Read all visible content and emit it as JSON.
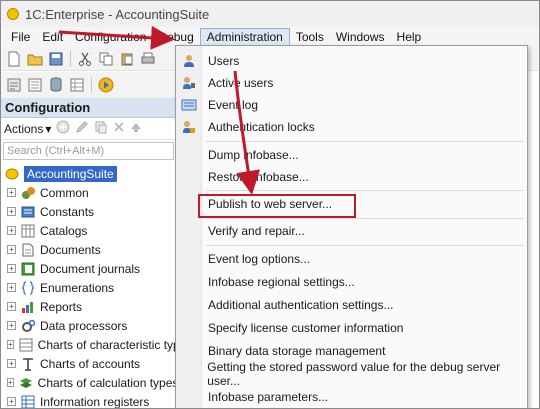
{
  "window": {
    "title": "1C:Enterprise - AccountingSuite"
  },
  "menubar": {
    "items": [
      {
        "label": "File",
        "active": false
      },
      {
        "label": "Edit",
        "active": false
      },
      {
        "label": "Configuration",
        "active": false
      },
      {
        "label": "Debug",
        "active": false
      },
      {
        "label": "Administration",
        "active": true
      },
      {
        "label": "Tools",
        "active": false
      },
      {
        "label": "Windows",
        "active": false
      },
      {
        "label": "Help",
        "active": false
      }
    ]
  },
  "config_panel": {
    "title": "Configuration",
    "actions_label": "Actions",
    "search_placeholder": "Search (Ctrl+Alt+M)",
    "root": "AccountingSuite",
    "items": [
      {
        "label": "Common",
        "icon": "common-icon"
      },
      {
        "label": "Constants",
        "icon": "constants-icon"
      },
      {
        "label": "Catalogs",
        "icon": "catalogs-icon"
      },
      {
        "label": "Documents",
        "icon": "documents-icon"
      },
      {
        "label": "Document journals",
        "icon": "document-journals-icon"
      },
      {
        "label": "Enumerations",
        "icon": "enumerations-icon"
      },
      {
        "label": "Reports",
        "icon": "reports-icon"
      },
      {
        "label": "Data processors",
        "icon": "data-processors-icon"
      },
      {
        "label": "Charts of characteristic types",
        "icon": "charts-of-characteristic-types-icon"
      },
      {
        "label": "Charts of accounts",
        "icon": "charts-of-accounts-icon"
      },
      {
        "label": "Charts of calculation types",
        "icon": "charts-of-calculation-types-icon"
      },
      {
        "label": "Information registers",
        "icon": "information-registers-icon"
      }
    ]
  },
  "admin_menu": {
    "groups": [
      [
        {
          "label": "Users",
          "icon": "users-icon"
        },
        {
          "label": "Active users",
          "icon": "active-users-icon"
        },
        {
          "label": "Event log",
          "icon": "event-log-icon"
        },
        {
          "label": "Authentication locks",
          "icon": "authentication-locks-icon"
        }
      ],
      [
        {
          "label": "Dump infobase..."
        },
        {
          "label": "Restore infobase..."
        }
      ],
      [
        {
          "label": "Publish to web server..."
        }
      ],
      [
        {
          "label": "Verify and repair..."
        }
      ],
      [
        {
          "label": "Event log options..."
        },
        {
          "label": "Infobase regional settings..."
        },
        {
          "label": "Additional authentication settings..."
        },
        {
          "label": "Specify license customer information"
        },
        {
          "label": "Binary data storage management"
        },
        {
          "label": "Getting the stored password value for the debug server user..."
        },
        {
          "label": "Infobase parameters..."
        }
      ]
    ]
  },
  "colors": {
    "highlight_box": "#c01a2a",
    "arrow": "#c01a2a",
    "selection": "#3468c8",
    "panel_header": "#d7e3f0"
  }
}
